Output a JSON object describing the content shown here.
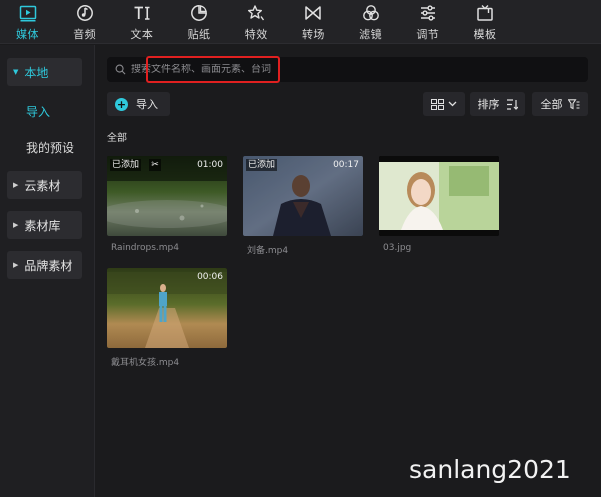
{
  "toolbar": {
    "tabs": [
      {
        "label": "媒体",
        "icon": "media-icon",
        "active": true
      },
      {
        "label": "音频",
        "icon": "audio-icon"
      },
      {
        "label": "文本",
        "icon": "text-icon"
      },
      {
        "label": "贴纸",
        "icon": "sticker-icon"
      },
      {
        "label": "特效",
        "icon": "effects-icon"
      },
      {
        "label": "转场",
        "icon": "transition-icon"
      },
      {
        "label": "滤镜",
        "icon": "filter-icon"
      },
      {
        "label": "调节",
        "icon": "adjust-icon"
      },
      {
        "label": "模板",
        "icon": "template-icon"
      }
    ]
  },
  "sidebar": {
    "local": "本地",
    "import": "导入",
    "my_presets": "我的预设",
    "cloud": "云素材",
    "library": "素材库",
    "brand": "品牌素材"
  },
  "search": {
    "placeholder": "搜索文件名称、画面元素、台词",
    "value": ""
  },
  "controls": {
    "import_label": "导入",
    "sort_label": "排序",
    "filter_label": "全部"
  },
  "section_label": "全部",
  "media": [
    {
      "name": "Raindrops.mp4",
      "added": "已添加",
      "duration": "01:00"
    },
    {
      "name": "刘备.mp4",
      "added": "已添加",
      "duration": "00:17"
    },
    {
      "name": "03.jpg"
    },
    {
      "name": "戴耳机女孩.mp4",
      "duration": "00:06"
    }
  ],
  "watermark": "sanlang2021",
  "colors": {
    "accent": "#2fc9dc",
    "highlight_box": "#e02020",
    "background": "#1b1b1d"
  }
}
